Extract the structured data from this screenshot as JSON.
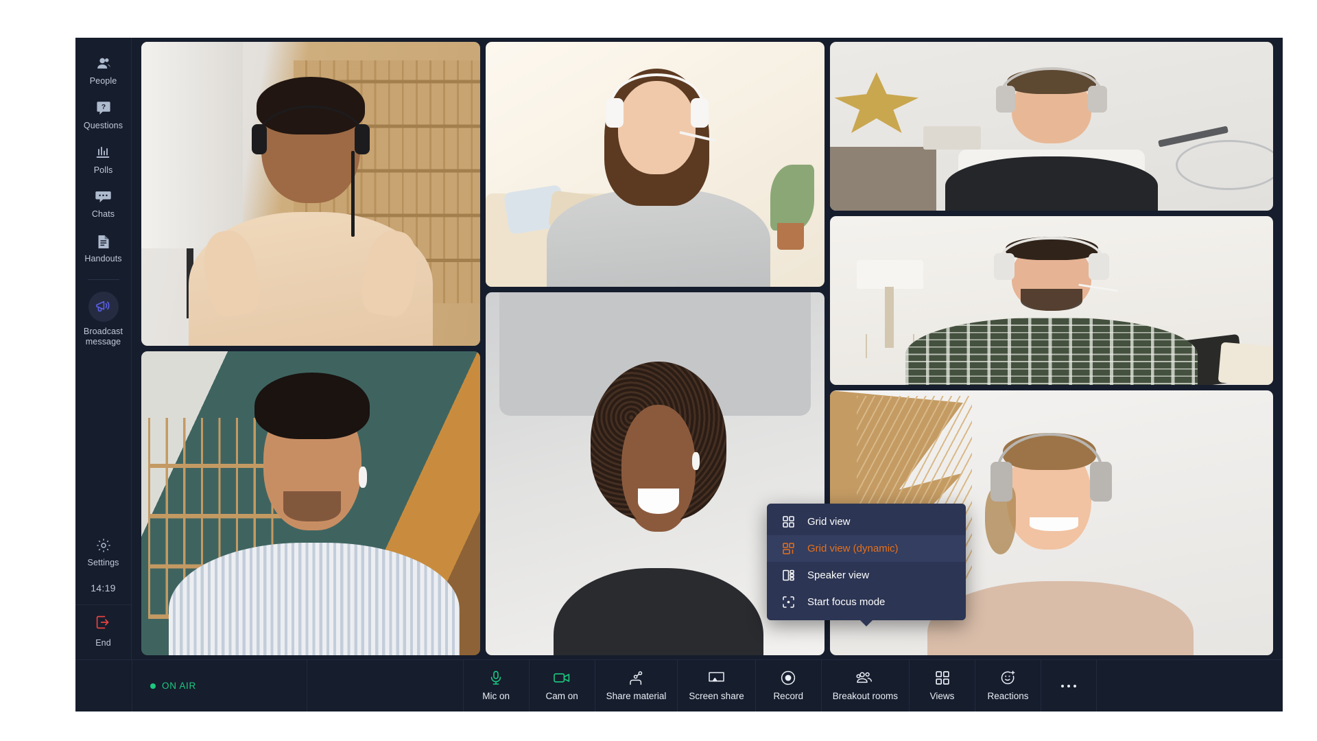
{
  "app": {
    "background_color": "#161d2d",
    "page_background": "#ffffff"
  },
  "sidebar": {
    "items": [
      {
        "icon": "people-icon",
        "label": "People"
      },
      {
        "icon": "question-icon",
        "label": "Questions"
      },
      {
        "icon": "polls-icon",
        "label": "Polls"
      },
      {
        "icon": "chat-icon",
        "label": "Chats"
      },
      {
        "icon": "handouts-icon",
        "label": "Handouts"
      }
    ],
    "broadcast": {
      "icon": "megaphone-icon",
      "label_line1": "Broadcast",
      "label_line2": "message",
      "accent": "#5b5fe8"
    },
    "settings": {
      "icon": "gear-icon",
      "label": "Settings"
    },
    "clock": "14:19",
    "end": {
      "icon": "exit-icon",
      "label": "End",
      "color": "#e8433f"
    }
  },
  "video_grid": {
    "participants": [
      {
        "position": "left-top",
        "description": "man with black headset in beige t-shirt, bookshelf background"
      },
      {
        "position": "left-bottom",
        "description": "man with earbuds in striped shirt, green bookshelf background"
      },
      {
        "position": "mid-top",
        "description": "woman with white headset in grey sweater, living room background"
      },
      {
        "position": "mid-bottom",
        "description": "woman with curly hair and earbuds, light wall background"
      },
      {
        "position": "right-top",
        "description": "man with white over-ear headphones in black tee, bike in background"
      },
      {
        "position": "right-mid",
        "description": "bearded man with white headset in checked shirt, floor lamp background"
      },
      {
        "position": "right-bottom",
        "description": "woman with grey headphones in beige sweatshirt, dried palm background"
      }
    ]
  },
  "views_menu": {
    "highlight_color": "#e8701a",
    "background": "#2c3553",
    "items": [
      {
        "icon": "grid-view-icon",
        "label": "Grid view",
        "active": false
      },
      {
        "icon": "grid-view-dynamic-icon",
        "label": "Grid view (dynamic)",
        "active": true
      },
      {
        "icon": "speaker-view-icon",
        "label": "Speaker view",
        "active": false
      },
      {
        "icon": "focus-mode-icon",
        "label": "Start focus mode",
        "active": false
      }
    ]
  },
  "toolbar": {
    "status": {
      "label": "ON AIR",
      "color": "#1cc97f"
    },
    "buttons": [
      {
        "icon": "mic-icon",
        "label": "Mic on",
        "color": "#1cc97f"
      },
      {
        "icon": "camera-icon",
        "label": "Cam on",
        "color": "#1cc97f"
      },
      {
        "icon": "share-material-icon",
        "label": "Share material",
        "color": "#eaeef5"
      },
      {
        "icon": "screen-share-icon",
        "label": "Screen share",
        "color": "#eaeef5"
      },
      {
        "icon": "record-icon",
        "label": "Record",
        "color": "#eaeef5"
      },
      {
        "icon": "breakout-rooms-icon",
        "label": "Breakout rooms",
        "color": "#eaeef5"
      },
      {
        "icon": "views-icon",
        "label": "Views",
        "color": "#eaeef5"
      },
      {
        "icon": "reactions-icon",
        "label": "Reactions",
        "color": "#eaeef5"
      }
    ],
    "more": {
      "icon": "more-icon",
      "label": "•••"
    }
  }
}
